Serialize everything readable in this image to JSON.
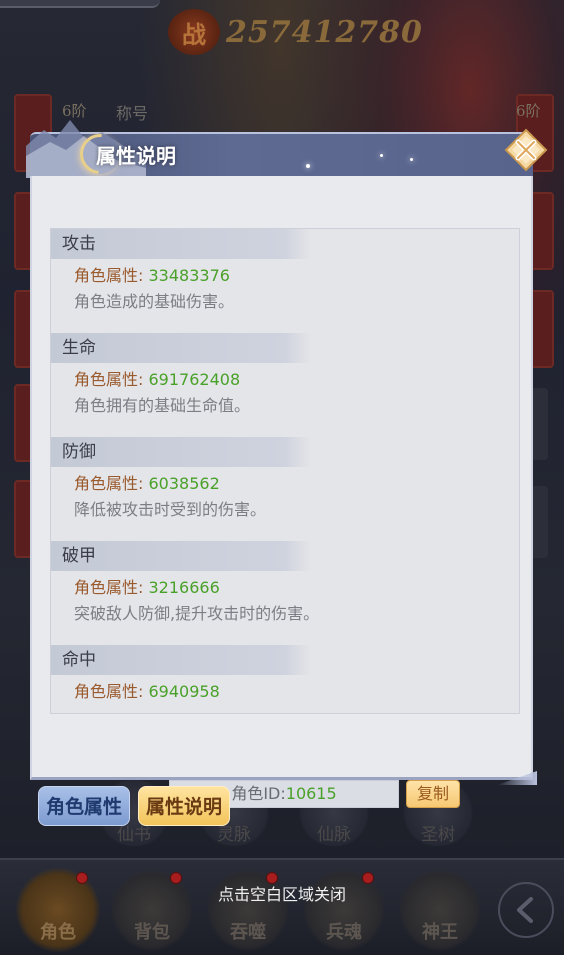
{
  "background": {
    "power_badge": "战",
    "power_value": "257412780",
    "tier_left": "6阶",
    "tier_right": "6阶",
    "title_label": "称号"
  },
  "modal": {
    "title": "属性说明",
    "sections": [
      {
        "name": "攻击",
        "key": "角色属性:",
        "value": "33483376",
        "desc": "角色造成的基础伤害。"
      },
      {
        "name": "生命",
        "key": "角色属性:",
        "value": "691762408",
        "desc": "角色拥有的基础生命值。"
      },
      {
        "name": "防御",
        "key": "角色属性:",
        "value": "6038562",
        "desc": "降低被攻击时受到的伤害。"
      },
      {
        "name": "破甲",
        "key": "角色属性:",
        "value": "3216666",
        "desc": "突破敌人防御,提升攻击时的伤害。"
      },
      {
        "name": "命中",
        "key": "角色属性:",
        "value": "6940958",
        "desc": ""
      }
    ],
    "role_id_label": "角色ID:",
    "role_id_value": "10615",
    "copy_label": "复制"
  },
  "tabs": {
    "role_attr": "角色属性",
    "attr_desc": "属性说明"
  },
  "menu_row": [
    "仙书",
    "灵脉",
    "仙脉",
    "圣树"
  ],
  "bottom_nav": [
    {
      "label": "角色",
      "active": true,
      "dot": true
    },
    {
      "label": "背包",
      "active": false,
      "dot": true
    },
    {
      "label": "吞噬",
      "active": false,
      "dot": true
    },
    {
      "label": "兵魂",
      "active": false,
      "dot": true
    },
    {
      "label": "神王",
      "active": false,
      "dot": false
    }
  ],
  "close_hint": "点击空白区域关闭",
  "colors": {
    "attr_key": "#9a5a2e",
    "attr_value": "#4aa12a",
    "desc_text": "#7c7e86",
    "modal_header": "#5e6a92",
    "tab_active": "#f2c45a"
  }
}
